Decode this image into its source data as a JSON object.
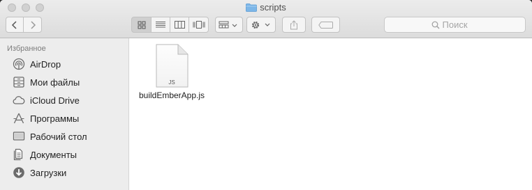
{
  "window": {
    "title": "scripts"
  },
  "toolbar": {
    "search_placeholder": "Поиск"
  },
  "sidebar": {
    "section_title": "Избранное",
    "items": [
      {
        "label": "AirDrop",
        "icon": "airdrop-icon"
      },
      {
        "label": "Мои файлы",
        "icon": "all-files-icon"
      },
      {
        "label": "iCloud Drive",
        "icon": "cloud-icon"
      },
      {
        "label": "Программы",
        "icon": "applications-icon"
      },
      {
        "label": "Рабочий стол",
        "icon": "desktop-icon"
      },
      {
        "label": "Документы",
        "icon": "documents-icon"
      },
      {
        "label": "Загрузки",
        "icon": "downloads-icon"
      }
    ]
  },
  "files": [
    {
      "name": "buildEmberApp.js",
      "badge": "JS"
    }
  ]
}
